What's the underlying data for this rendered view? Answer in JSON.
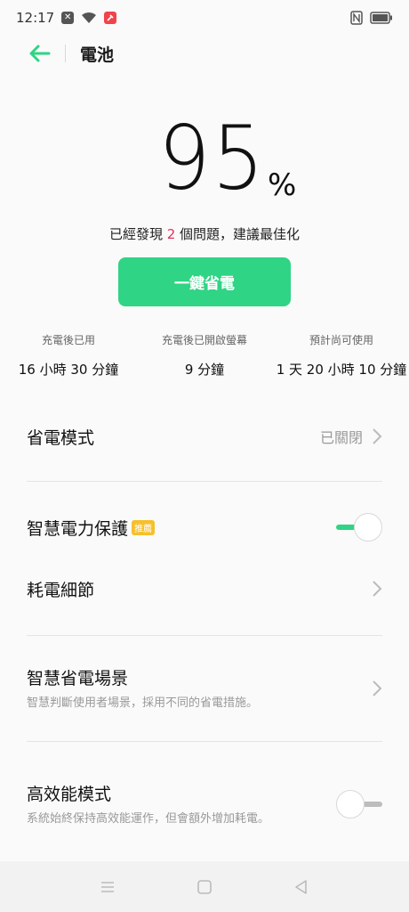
{
  "status_bar": {
    "time": "12:17",
    "icons_left": [
      "close-notification-icon",
      "wifi-icon",
      "app-notification-icon"
    ],
    "icons_right": [
      "nfc-icon",
      "battery-icon"
    ]
  },
  "app_bar": {
    "title": "電池",
    "back_icon": "back-arrow-icon"
  },
  "battery": {
    "level": "95",
    "unit": "%"
  },
  "issues": {
    "prefix": "已經發現 ",
    "count": "2",
    "suffix": " 個問題，建議最佳化"
  },
  "optimize_button": "一鍵省電",
  "stats": [
    {
      "label": "充電後已用",
      "value": "16 小時 30 分鐘"
    },
    {
      "label": "充電後已開啟螢幕",
      "value": "9 分鐘"
    },
    {
      "label": "預計尚可使用",
      "value": "1 天 20 小時 10 分鐘"
    }
  ],
  "settings": {
    "power_saving": {
      "title": "省電模式",
      "status": "已關閉"
    },
    "smart_power": {
      "title": "智慧電力保護",
      "badge": "推薦",
      "enabled": true
    },
    "usage_details": {
      "title": "耗電細節"
    },
    "smart_scenes": {
      "title": "智慧省電場景",
      "subtitle": "智慧判斷使用者場景，採用不同的省電措施。"
    },
    "high_performance": {
      "title": "高效能模式",
      "subtitle": "系統始終保持高效能運作，但會額外增加耗電。",
      "enabled": false
    }
  },
  "colors": {
    "accent": "#2fd484",
    "issue_count": "#e0315d",
    "badge": "#f6c02c"
  },
  "nav_bar": [
    "menu-icon",
    "home-icon",
    "back-icon"
  ]
}
